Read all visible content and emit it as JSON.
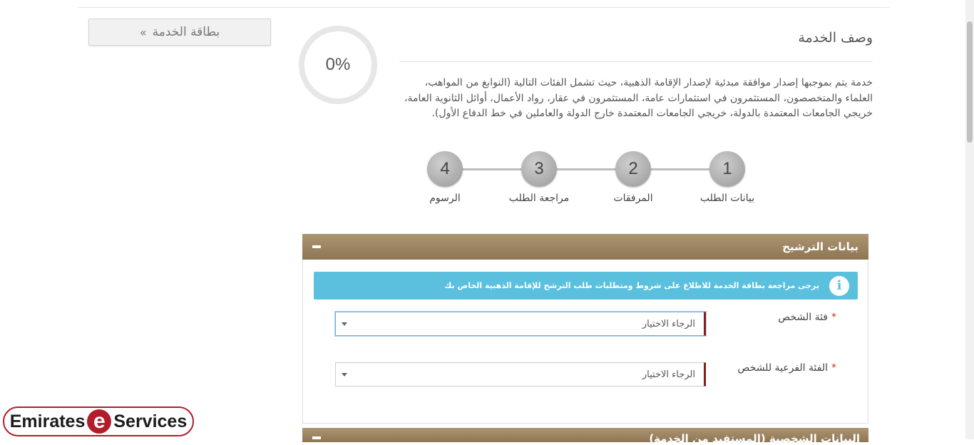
{
  "service_card_button": {
    "label": "بطاقة الخدمة",
    "icon": "double-chevron-right-icon"
  },
  "progress": {
    "percent_label": "0%",
    "value": 0
  },
  "service": {
    "title": "وصف الخدمة",
    "description": "خدمة يتم بموجبها إصدار موافقة مبدئية لإصدار الإقامة الذهبية، حيث تشمل الفئات التالية (النوابغ من المواهب، العلماء والمتخصصون، المستثمرون في استثمارات عامة، المستثمرون في عقار، رواد الأعمال، أوائل الثانوية العامة، خريجي الجامعات المعتمدة بالدولة، خريجي الجامعات المعتمدة خارج الدولة والعاملين في خط الدفاع الأول)."
  },
  "steps": [
    {
      "number": "1",
      "label": "بيانات الطلب"
    },
    {
      "number": "2",
      "label": "المرفقات"
    },
    {
      "number": "3",
      "label": "مراجعة الطلب"
    },
    {
      "number": "4",
      "label": "الرسوم"
    }
  ],
  "panel": {
    "title": "بيانات الترشيح",
    "info_text": "يرجى مراجعة بطاقة الخدمة للاطلاع على شروط ومتطلبات طلب الترشح للإقامة الذهبية الخاص بك",
    "fields": [
      {
        "label": "فئة الشخص",
        "required": "*",
        "value": "الرجاء الاختيار"
      },
      {
        "label": "الفئة الفرعية للشخص",
        "required": "*",
        "value": "الرجاء الاختيار"
      }
    ]
  },
  "next_panel": {
    "title": "البيانات الشخصية (المستفيد من الخدمة)"
  },
  "logo": {
    "left_text": "Emirates",
    "middle_letter": "e",
    "right_text": "Services"
  },
  "colors": {
    "panel_header": "#9b8260",
    "info_bar": "#5bc0de",
    "required": "#c0392b",
    "logo_red": "#b11d2a"
  }
}
